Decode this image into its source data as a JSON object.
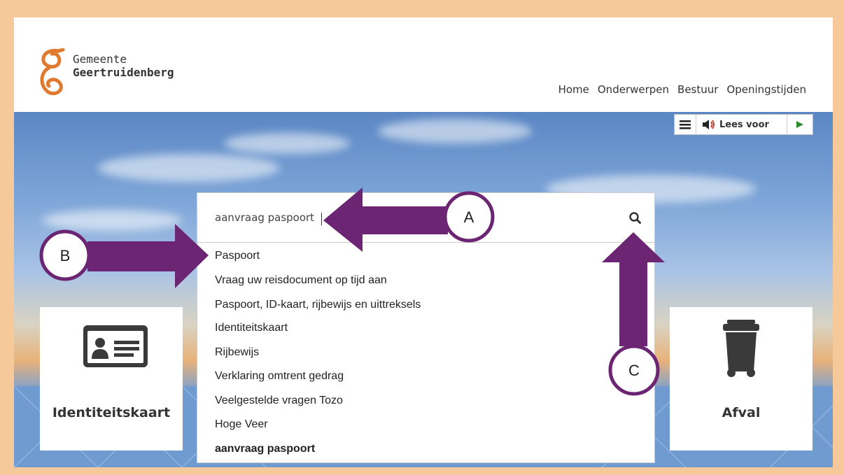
{
  "header": {
    "logo_line1": "Gemeente",
    "logo_line2": "Geertruidenberg",
    "nav": [
      "Home",
      "Onderwerpen",
      "Bestuur",
      "Openingstijden"
    ]
  },
  "toolbar": {
    "menu_icon": "hamburger-icon",
    "read_label": "Lees voor",
    "speaker_icon": "speaker-icon",
    "play_icon": "play-icon"
  },
  "search": {
    "value": "aanvraag paspoort",
    "icon": "search-icon"
  },
  "suggestions": [
    {
      "label": "Paspoort",
      "bold": false
    },
    {
      "label": "Vraag uw reisdocument op tijd aan",
      "bold": false
    },
    {
      "label": "Paspoort, ID-kaart, rijbewijs en uittreksels",
      "bold": false
    },
    {
      "label": "Identiteitskaart",
      "bold": false
    },
    {
      "label": "Rijbewijs",
      "bold": false
    },
    {
      "label": "Verklaring omtrent gedrag",
      "bold": false
    },
    {
      "label": "Veelgestelde vragen Tozo",
      "bold": false
    },
    {
      "label": "Hoge Veer",
      "bold": false
    },
    {
      "label": "aanvraag paspoort",
      "bold": true
    }
  ],
  "tiles": {
    "left": {
      "label": "Identiteitskaart",
      "icon": "id-card-icon"
    },
    "right": {
      "label": "Afval",
      "icon": "trash-bin-icon"
    }
  },
  "annotations": {
    "a": "A",
    "b": "B",
    "c": "C"
  },
  "colors": {
    "frame": "#f5c99a",
    "logo_orange": "#e07a2e",
    "annotation_purple": "#6b2573",
    "play_green": "#2e8b2e"
  }
}
